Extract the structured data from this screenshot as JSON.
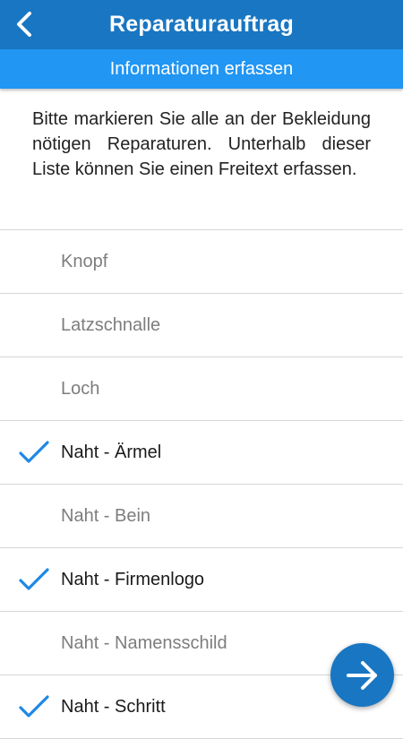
{
  "header": {
    "title": "Reparaturauftrag",
    "subtitle": "Informationen erfassen",
    "back_icon": "chevron-left-icon"
  },
  "intro": {
    "text": "Bitte markieren Sie alle an der Bekleidung nötigen Reparaturen. Unterhalb dieser Liste können Sie einen Freitext erfassen."
  },
  "repairs": {
    "items": [
      {
        "label": "Knopf",
        "checked": false
      },
      {
        "label": "Latzschnalle",
        "checked": false
      },
      {
        "label": "Loch",
        "checked": false
      },
      {
        "label": "Naht - Ärmel",
        "checked": true
      },
      {
        "label": "Naht - Bein",
        "checked": false
      },
      {
        "label": "Naht - Firmenlogo",
        "checked": true
      },
      {
        "label": "Naht - Namensschild",
        "checked": false
      },
      {
        "label": "Naht - Schritt",
        "checked": true
      }
    ]
  },
  "fab": {
    "icon": "arrow-right-icon"
  },
  "colors": {
    "appbar": "#1976c2",
    "subbar": "#2196f3",
    "check": "#1e88e5"
  }
}
